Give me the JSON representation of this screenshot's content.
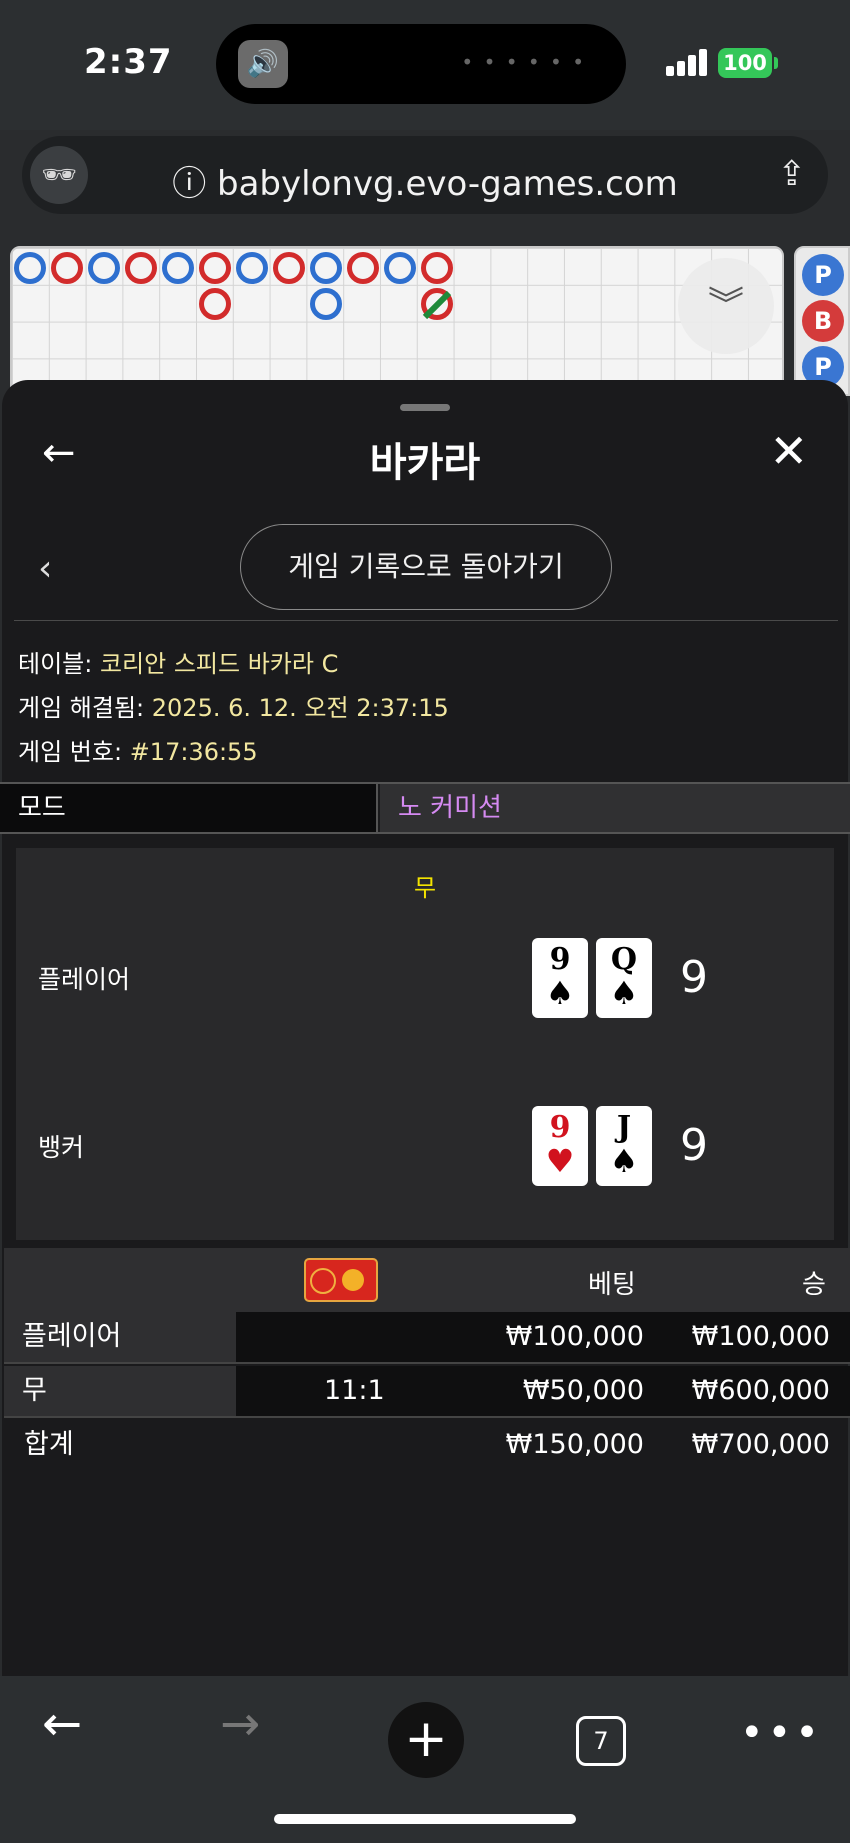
{
  "status_bar": {
    "time": "2:37",
    "battery": "100"
  },
  "browser": {
    "url": "babylonvg.evo-games.com",
    "tab_count": "7"
  },
  "sheet": {
    "title": "바카라",
    "back_to_history": "게임 기록으로 돌아가기",
    "info": {
      "table_label": "테이블:",
      "table_value": "코리안 스피드 바카라 C",
      "resolved_label": "게임 해결됨:",
      "resolved_value": "2025. 6. 12. 오전 2:37:15",
      "number_label": "게임 번호:",
      "number_value": "#17:36:55"
    },
    "mode": {
      "label": "모드",
      "value": "노 커미션"
    },
    "result": {
      "outcome": "무",
      "player_label": "플레이어",
      "player_cards": [
        {
          "rank": "9",
          "suit": "♠",
          "color": "black"
        },
        {
          "rank": "Q",
          "suit": "♠",
          "color": "black"
        }
      ],
      "player_score": "9",
      "banker_label": "뱅커",
      "banker_cards": [
        {
          "rank": "9",
          "suit": "♥",
          "color": "red"
        },
        {
          "rank": "J",
          "suit": "♠",
          "color": "black"
        }
      ],
      "banker_score": "9"
    },
    "bets": {
      "header": {
        "bet": "베팅",
        "win": "승"
      },
      "rows": [
        {
          "name": "플레이어",
          "payout": "",
          "bet": "₩100,000",
          "win": "₩100,000"
        },
        {
          "name": "무",
          "payout": "11:1",
          "bet": "₩50,000",
          "win": "₩600,000"
        }
      ],
      "total": {
        "name": "합계",
        "bet": "₩150,000",
        "win": "₩700,000"
      }
    }
  },
  "roadmap": {
    "side_pills": [
      "P",
      "B",
      "P"
    ],
    "colors": {
      "player": "#2e6fcf",
      "banker": "#d22b2b",
      "tie": "#1f8a3a"
    }
  }
}
